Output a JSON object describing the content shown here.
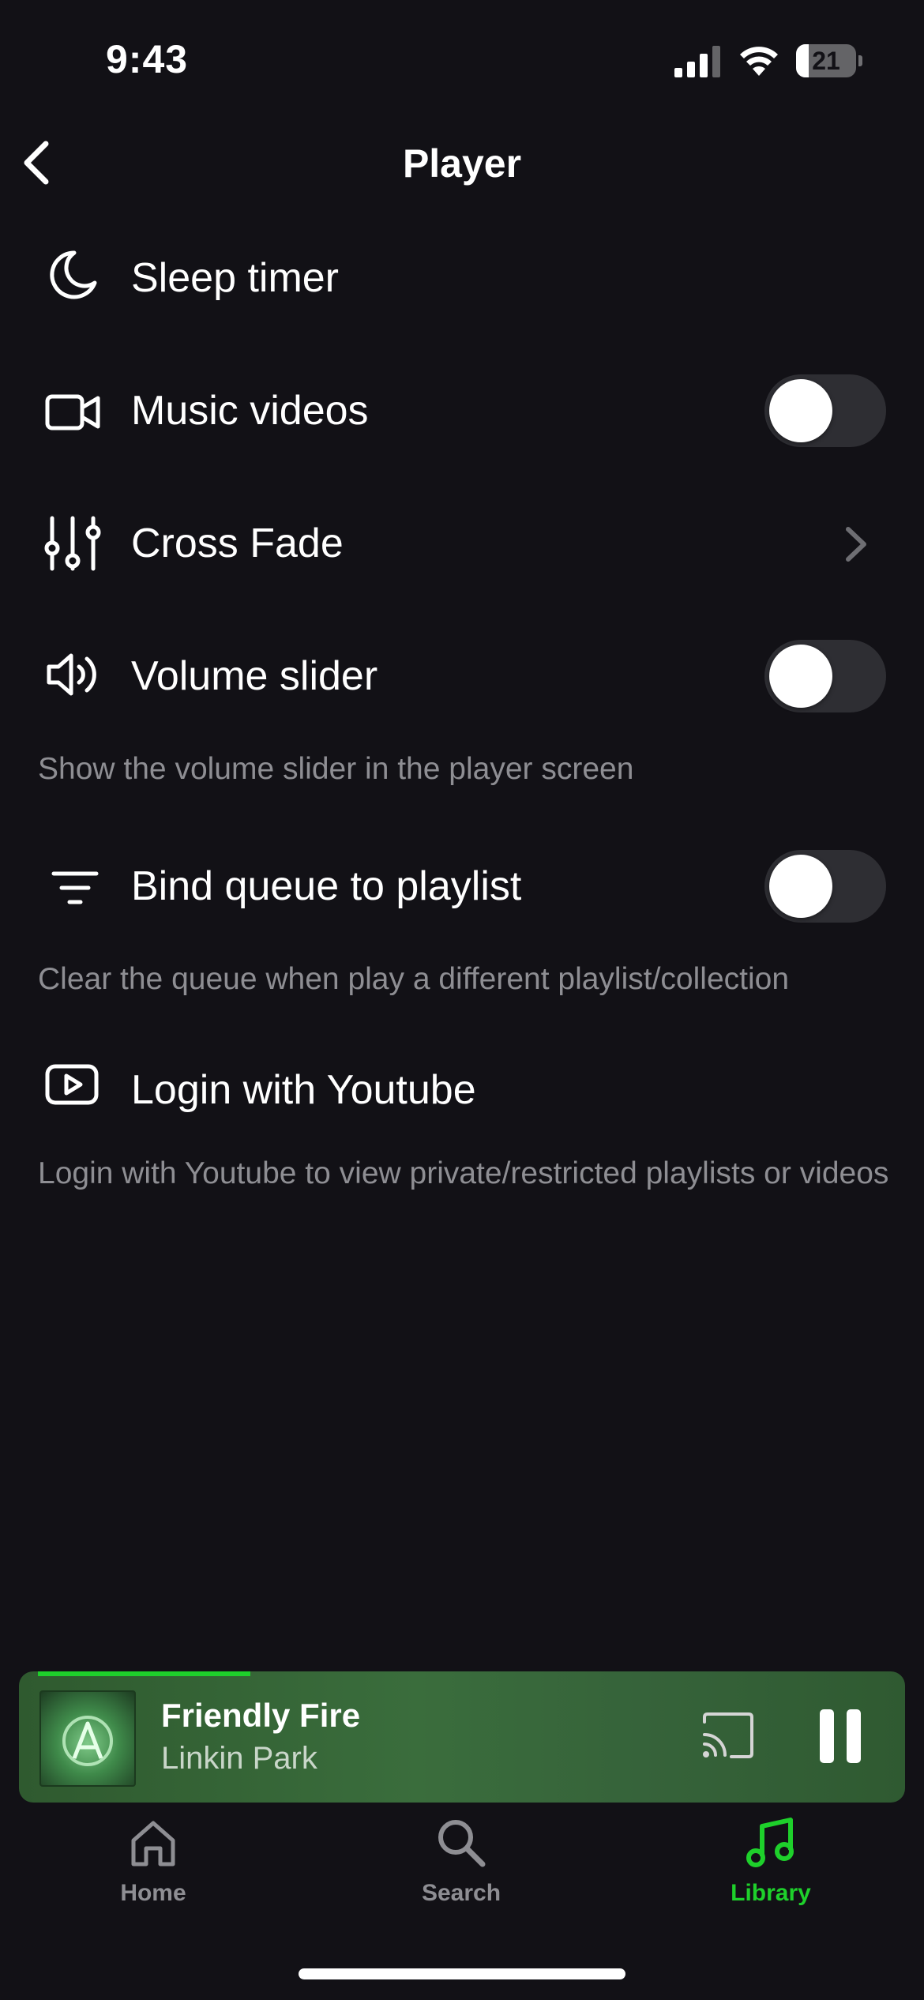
{
  "status_bar": {
    "time": "9:43",
    "battery": "21",
    "battery_level": 0.21
  },
  "header": {
    "title": "Player"
  },
  "settings": [
    {
      "label": "Sleep timer",
      "icon": "moon-icon"
    },
    {
      "label": "Music videos",
      "icon": "video-camera-icon",
      "toggle": false
    },
    {
      "label": "Cross Fade",
      "icon": "equalizer-icon"
    },
    {
      "label": "Volume slider",
      "icon": "speaker-icon",
      "toggle": false,
      "description": "Show the volume slider in the player screen"
    },
    {
      "label": "Bind queue to playlist",
      "icon": "filter-icon",
      "toggle": false,
      "description": "Clear the queue when play a different playlist/collection"
    },
    {
      "label": "Login with Youtube",
      "icon": "youtube-icon",
      "description": "Login with Youtube to view private/restricted playlists or videos"
    }
  ],
  "now_playing": {
    "title": "Friendly Fire",
    "artist": "Linkin Park",
    "progress": 0.245
  },
  "tabs": [
    {
      "label": "Home",
      "icon": "home-icon",
      "active": false
    },
    {
      "label": "Search",
      "icon": "search-icon",
      "active": false
    },
    {
      "label": "Library",
      "icon": "music-note-icon",
      "active": true
    }
  ],
  "colors": {
    "background": "#121116",
    "accent": "#1ed02b",
    "text_secondary": "#8e8e93",
    "toggle_off": "#2e2e33"
  }
}
